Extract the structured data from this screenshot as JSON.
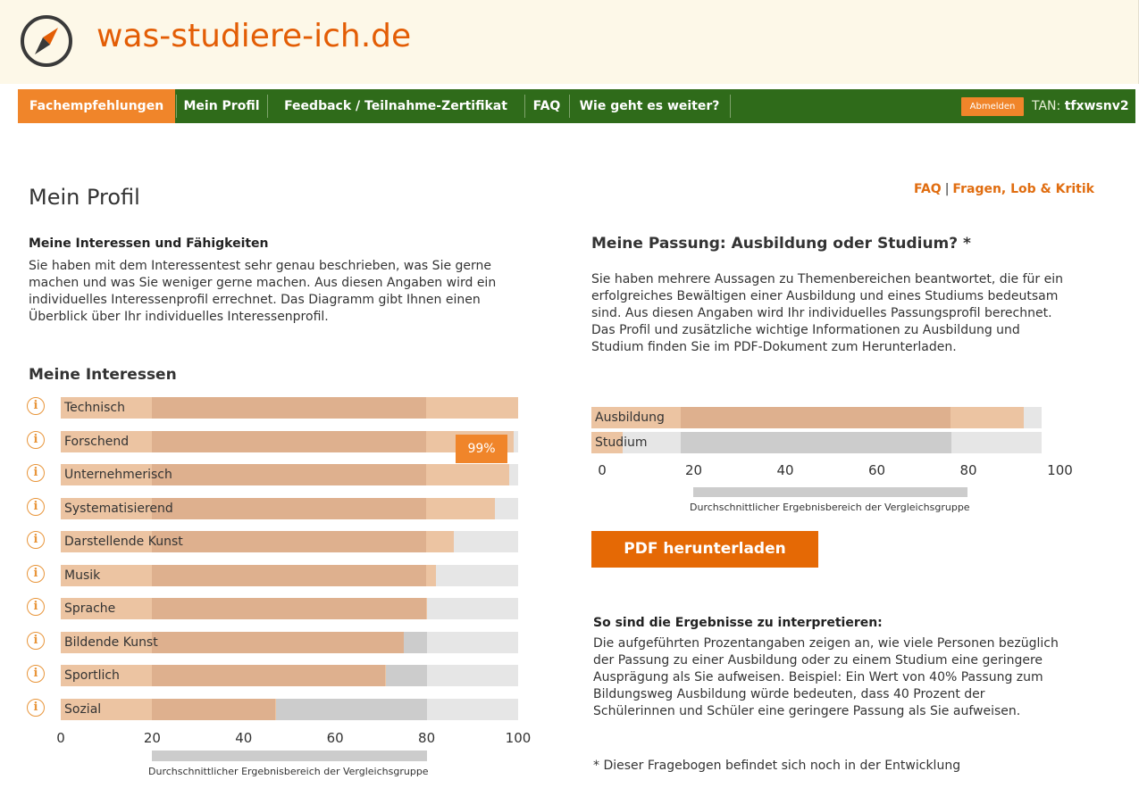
{
  "header": {
    "site_title": "was-studiere-ich.de",
    "logo_icon": "compass-icon",
    "brand_color": "#e35d05"
  },
  "nav": {
    "items": [
      {
        "label": "Fachempfehlungen",
        "active": true
      },
      {
        "label": "Mein Profil",
        "active": false
      },
      {
        "label": "Feedback / Teilnahme-Zertifikat",
        "active": false
      },
      {
        "label": "FAQ",
        "active": false
      },
      {
        "label": "Wie geht es weiter?",
        "active": false
      }
    ],
    "logout_label": "Abmelden",
    "tan_prefix": "TAN:",
    "tan_value": "tfxwsnv2",
    "bar_color": "#2f6b1a",
    "active_color": "#f0852a"
  },
  "page": {
    "title": "Mein Profil",
    "links": {
      "faq": "FAQ",
      "separator": "|",
      "feedback": "Fragen, Lob & Kritik"
    }
  },
  "interests_section": {
    "heading": "Meine Interessen und Fähigkeiten",
    "text": "Sie haben mit dem Interessentest sehr genau beschrieben, was Sie gerne machen und was Sie weniger gerne machen. Aus diesen Angaben wird ein individuelles Interessenprofil errechnet. Das Diagramm gibt Ihnen einen Überblick über Ihr individuelles Interessenprofil.",
    "chart_heading": "Meine Interessen",
    "tooltip": "99%"
  },
  "chart_data": [
    {
      "type": "bar",
      "orientation": "horizontal",
      "title": "Meine Interessen",
      "categories": [
        "Technisch",
        "Forschend",
        "Unternehmerisch",
        "Systematisierend",
        "Darstellende Kunst",
        "Musik",
        "Sprache",
        "Bildende Kunst",
        "Sportlich",
        "Sozial"
      ],
      "values": [
        100,
        99,
        98,
        95,
        86,
        82,
        80,
        75,
        71,
        47
      ],
      "xlim": [
        0,
        100
      ],
      "xticks": [
        "0",
        "20",
        "40",
        "60",
        "80",
        "100"
      ],
      "avg_range": [
        20,
        80
      ],
      "avg_range_label": "Durchschnittlicher Ergebnisbereich der Vergleichsgruppe",
      "colors": {
        "value": "#ecc4a2",
        "value_in_range": "#deb08e",
        "range": "#cccccc",
        "background": "#e6e6e6"
      }
    },
    {
      "type": "bar",
      "orientation": "horizontal",
      "title": "Meine Passung: Ausbildung oder Studium? *",
      "categories": [
        "Ausbildung",
        "Studium"
      ],
      "values": [
        96,
        7
      ],
      "xlim": [
        0,
        100
      ],
      "xticks": [
        "0",
        "20",
        "40",
        "60",
        "80",
        "100"
      ],
      "avg_range": [
        20,
        80
      ],
      "avg_range_label": "Durchschnittlicher Ergebnisbereich der Vergleichsgruppe"
    }
  ],
  "passung_section": {
    "heading": "Meine Passung: Ausbildung oder Studium? *",
    "text": "Sie haben mehrere Aussagen zu Themenbereichen beantwortet, die für ein erfolgreiches Bewältigen einer Ausbildung und eines Studiums bedeutsam sind. Aus diesen Angaben wird Ihr individuelles Passungsprofil berechnet. Das Profil und zusätzliche wichtige Informationen zu Ausbildung und Studium finden Sie im PDF-Dokument zum Herunterladen.",
    "pdf_button": "PDF herunterladen"
  },
  "interpretation": {
    "heading": "So sind die Ergebnisse zu interpretieren:",
    "text": "Die aufgeführten Prozentangaben zeigen an, wie viele Personen bezüglich der Passung zu einer Ausbildung oder zu einem Studium eine geringere Ausprägung als Sie aufweisen. Beispiel: Ein Wert von 40% Passung zum Bildungsweg Ausbildung würde bedeuten, dass 40 Prozent der Schülerinnen und Schüler eine geringere Passung als Sie aufweisen.",
    "footnote": "* Dieser Fragebogen befindet sich noch in der Entwicklung"
  }
}
